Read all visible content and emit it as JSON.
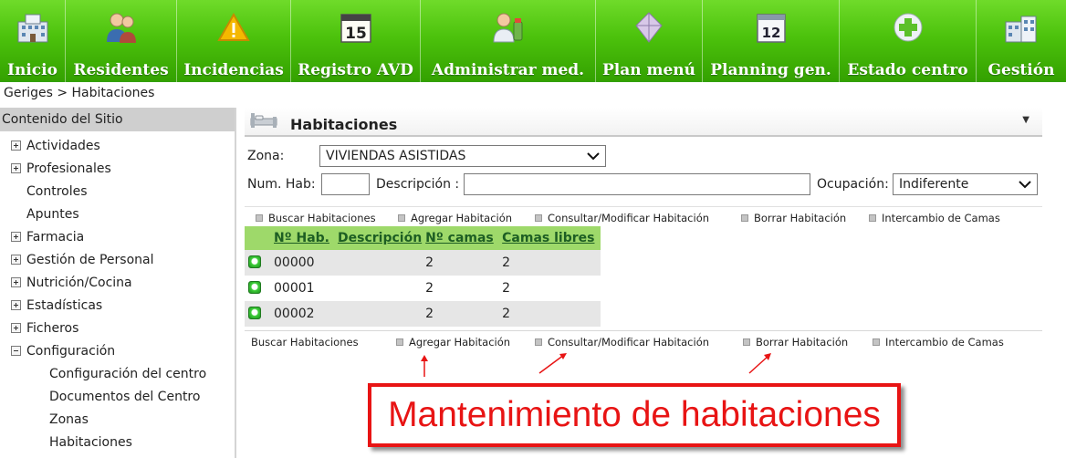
{
  "nav": {
    "items": [
      {
        "label": "Inicio",
        "icon": "building-icon"
      },
      {
        "label": "Residentes",
        "icon": "residents-icon"
      },
      {
        "label": "Incidencias",
        "icon": "warning-icon"
      },
      {
        "label": "Registro AVD",
        "icon": "calendar-15-icon"
      },
      {
        "label": "Administrar med.",
        "icon": "pharmacist-icon"
      },
      {
        "label": "Plan menú",
        "icon": "menu-plan-icon"
      },
      {
        "label": "Planning gen.",
        "icon": "calendar-12-icon"
      },
      {
        "label": "Estado centro",
        "icon": "medical-cross-icon"
      },
      {
        "label": "Gestión",
        "icon": "buildings-icon"
      }
    ]
  },
  "breadcrumb": "Geriges > Habitaciones",
  "sidebar": {
    "title": "Contenido del Sitio",
    "items": [
      {
        "label": "Actividades",
        "toggle": "plus"
      },
      {
        "label": "Profesionales",
        "toggle": "plus"
      },
      {
        "label": "Controles",
        "toggle": "none"
      },
      {
        "label": "Apuntes",
        "toggle": "none"
      },
      {
        "label": "Farmacia",
        "toggle": "plus"
      },
      {
        "label": "Gestión de Personal",
        "toggle": "plus"
      },
      {
        "label": "Nutrición/Cocina",
        "toggle": "plus"
      },
      {
        "label": "Estadísticas",
        "toggle": "plus"
      },
      {
        "label": "Ficheros",
        "toggle": "plus"
      },
      {
        "label": "Configuración",
        "toggle": "minus"
      },
      {
        "label": "Configuración del centro",
        "toggle": "child"
      },
      {
        "label": "Documentos del Centro",
        "toggle": "child"
      },
      {
        "label": "Zonas",
        "toggle": "child"
      },
      {
        "label": "Habitaciones",
        "toggle": "child"
      }
    ]
  },
  "main": {
    "title": "Habitaciones",
    "filters": {
      "zona_label": "Zona:",
      "zona_value": "VIVIENDAS ASISTIDAS",
      "numhab_label": "Num. Hab:",
      "numhab_value": "",
      "descripcion_label": "Descripción :",
      "descripcion_value": "",
      "ocupacion_label": "Ocupación:",
      "ocupacion_value": "Indiferente"
    },
    "actions": [
      "Buscar Habitaciones",
      "Agregar Habitación",
      "Consultar/Modificar Habitación",
      "Borrar Habitación",
      "Intercambio de Camas"
    ],
    "table": {
      "headers": [
        "Nº Hab.",
        "Descripción",
        "Nº camas",
        "Camas libres"
      ],
      "rows": [
        [
          "00000",
          "",
          "2",
          "2"
        ],
        [
          "00001",
          "",
          "2",
          "2"
        ],
        [
          "00002",
          "",
          "2",
          "2"
        ]
      ]
    }
  },
  "annotation": {
    "text": "Mantenimiento de habitaciones",
    "color": "#e81414"
  },
  "colors": {
    "nav_green": "#4cc20c",
    "table_header": "#9ed96a",
    "header_text": "#1d5e23"
  }
}
